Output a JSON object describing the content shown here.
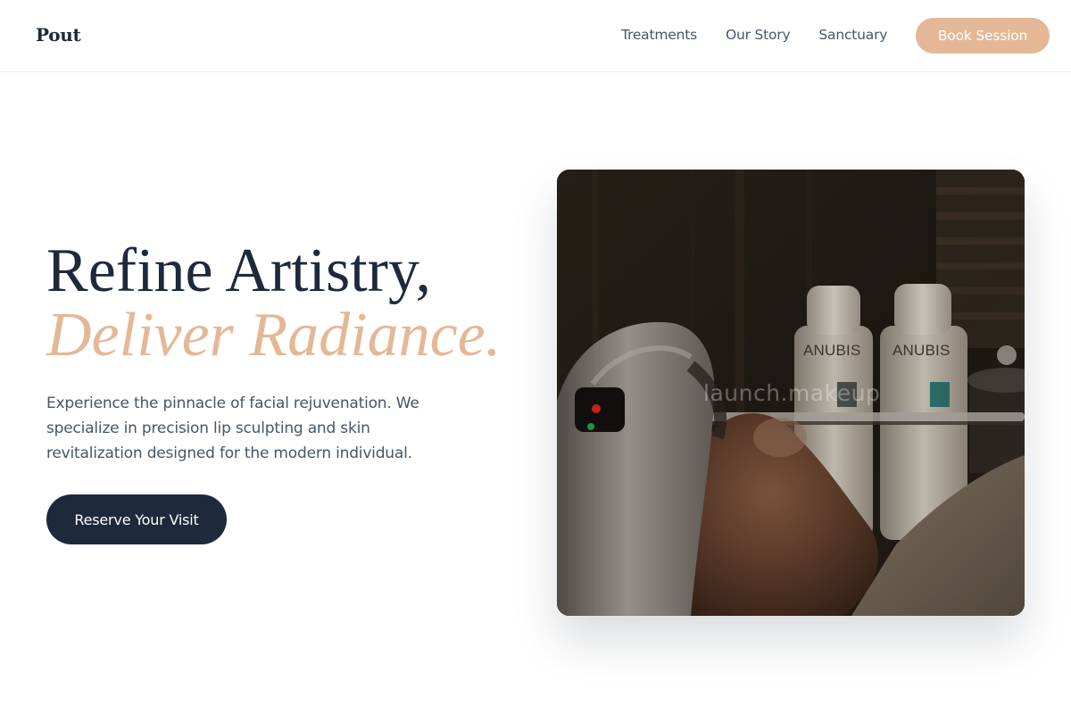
{
  "brand": {
    "logo": "Pout"
  },
  "nav": {
    "links": [
      "Treatments",
      "Our Story",
      "Sanctuary"
    ],
    "cta_label": "Book Session"
  },
  "hero": {
    "headline_line1": "Refine Artistry,",
    "headline_line2": "Deliver Radiance.",
    "description": "Experience the pinnacle of facial rejuvenation. We specialize in precision lip sculpting and skin revitalization designed for the modern individual.",
    "cta_label": "Reserve Your Visit",
    "image": {
      "watermark": "launch.makeup",
      "product_labels": [
        "ANUBIS",
        "ANUBIS"
      ]
    }
  },
  "colors": {
    "primary": "#1e293b",
    "accent": "#e4b896",
    "body_text": "#475569"
  }
}
